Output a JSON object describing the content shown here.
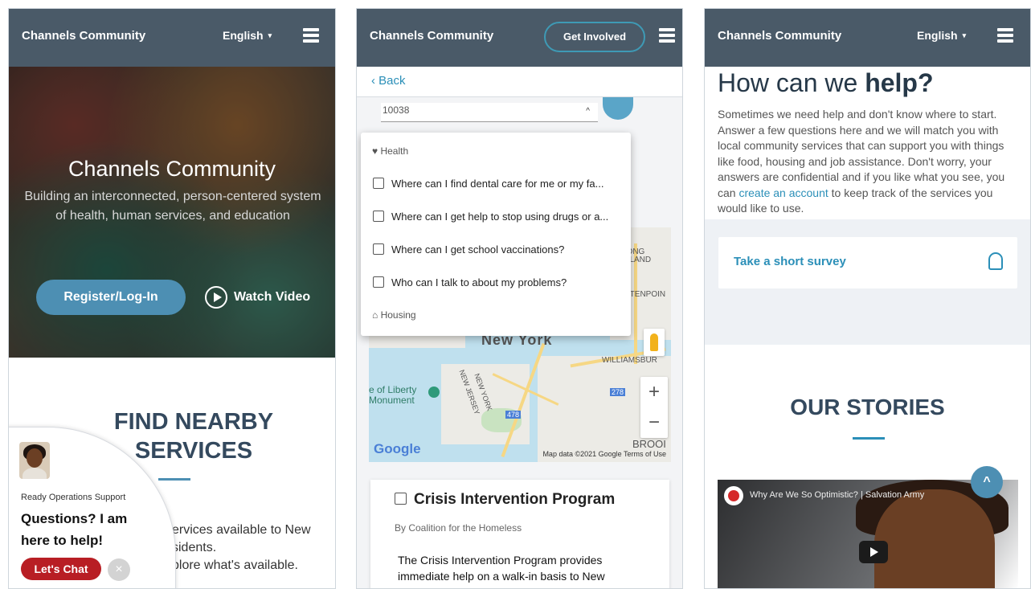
{
  "panel1": {
    "header": {
      "brand": "Channels Community",
      "language": "English",
      "caret": "▾"
    },
    "hero": {
      "title": "Channels Community",
      "subtitle": "Building an interconnected, person-centered system of health, human services, and education",
      "register_label": "Register/Log-In",
      "watch_label": "Watch Video"
    },
    "find": {
      "title": "FIND NEARBY SERVICES",
      "body_lines": [
        "services available to New",
        "sidents.",
        "plore what's available."
      ]
    },
    "chat": {
      "org": "Ready Operations Support",
      "question": "Questions? I am here to help!",
      "chat_label": "Let's Chat",
      "close_glyph": "×"
    }
  },
  "panel2": {
    "header": {
      "brand": "Channels Community",
      "get_involved": "Get Involved"
    },
    "back_label": "‹ Back",
    "zip_value": "10038",
    "zip_toggle": "^",
    "dropdown": {
      "health_group": "♥ Health",
      "items": [
        "Where can I find dental care for me or my fa...",
        "Where can I get help to stop using drugs or a...",
        "Where can I get school vaccinations?",
        "Who can I talk to about my problems?"
      ],
      "housing_group": "⌂ Housing"
    },
    "map": {
      "city_label": "New York",
      "liberty_label": "e of Liberty Monument",
      "nj_label": "NEW JERSEY",
      "ny_label": "NEW YORK",
      "long_island_label": "LONG ISLAND CI",
      "williamsburg_label": "WILLIAMSBUR",
      "huntpoint_label": "ETENPOIN",
      "broo_label": "BROOI",
      "route_278": "278",
      "route_478": "478",
      "google_label": "Google",
      "attribution": "Map data ©2021 Google   Terms of Use",
      "zoom_in": "+",
      "zoom_out": "−"
    },
    "card": {
      "title": "Crisis Intervention Program",
      "by": "By Coalition for the Homeless",
      "body": "The Crisis Intervention Program provides immediate help on a walk-in basis to New Yorkers who are homeless, on the brink of"
    }
  },
  "panel3": {
    "header": {
      "brand": "Channels Community",
      "language": "English",
      "caret": "▾"
    },
    "help_title_prefix": "How can we ",
    "help_title_bold": "help?",
    "help_body_before": "Sometimes we need help and don't know where to start. Answer a few questions here and we will match you with local community services that can support you with things like food, housing and job assistance. Don't worry, your answers are confidential and if you like what you see, you can ",
    "help_link": "create an account",
    "help_body_after": " to keep track of the services you would like to use.",
    "survey_label": "Take a short survey",
    "stories_title": "OUR STORIES",
    "video_title": "Why Are We So Optimistic? | Salvation Army",
    "scroll_top_glyph": "^"
  },
  "colors": {
    "header_bg": "#4a5a68",
    "accent_blue": "#4d8fb3",
    "link_blue": "#2b8fb8",
    "chat_red": "#b81e24",
    "heading_dark": "#34495e"
  }
}
